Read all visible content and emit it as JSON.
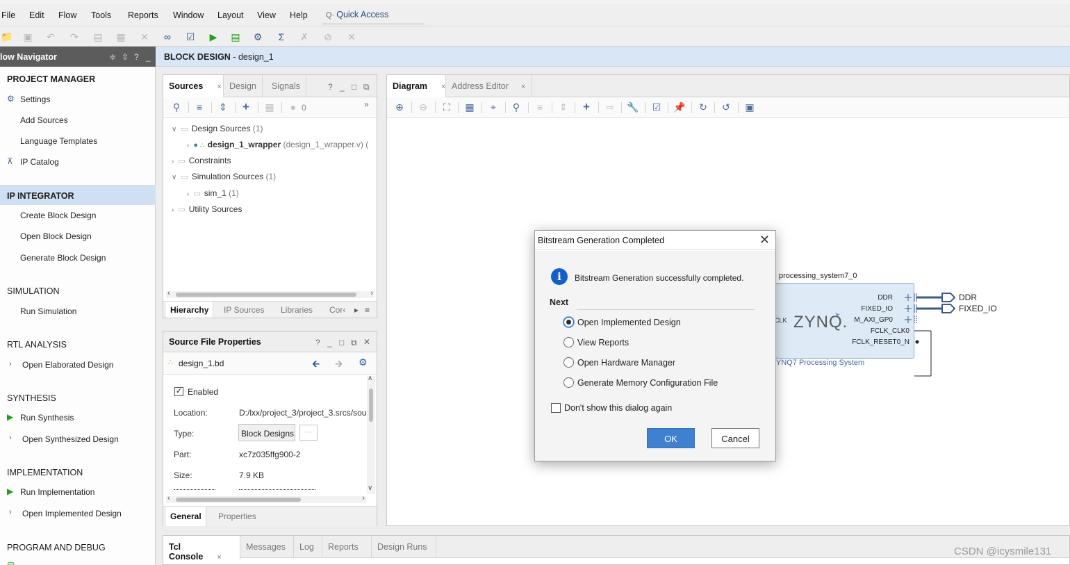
{
  "menubar": {
    "items": [
      "File",
      "Edit",
      "Flow",
      "Tools",
      "Reports",
      "Window",
      "Layout",
      "View",
      "Help"
    ],
    "quick_access": "Quick Access"
  },
  "flow_navigator": {
    "title": "low Navigator",
    "controls": [
      "≑",
      "⇳",
      "?",
      "_"
    ],
    "sections": {
      "project_manager": {
        "label": "PROJECT MANAGER",
        "items": [
          "Settings",
          "Add Sources",
          "Language Templates",
          "IP Catalog"
        ]
      },
      "ip_integrator": {
        "label": "IP INTEGRATOR",
        "items": [
          "Create Block Design",
          "Open Block Design",
          "Generate Block Design"
        ]
      },
      "simulation": {
        "label": "SIMULATION",
        "items": [
          "Run Simulation"
        ]
      },
      "rtl_analysis": {
        "label": "RTL ANALYSIS",
        "items": [
          "Open Elaborated Design"
        ]
      },
      "synthesis": {
        "label": "SYNTHESIS",
        "items": [
          "Run Synthesis",
          "Open Synthesized Design"
        ]
      },
      "implementation": {
        "label": "IMPLEMENTATION",
        "items": [
          "Run Implementation",
          "Open Implemented Design"
        ]
      },
      "program_debug": {
        "label": "PROGRAM AND DEBUG"
      }
    }
  },
  "block_design": {
    "title": "BLOCK DESIGN",
    "name": " - design_1"
  },
  "sources_panel": {
    "tabs": [
      "Sources",
      "Design",
      "Signals"
    ],
    "controls": [
      "?",
      "_",
      "□",
      "⧉"
    ],
    "count": "0",
    "tree": {
      "design_sources": "Design Sources",
      "design_sources_count": "(1)",
      "wrapper": "design_1_wrapper",
      "wrapper_file": "(design_1_wrapper.v) (",
      "constraints": "Constraints",
      "simulation_sources": "Simulation Sources",
      "simulation_sources_count": "(1)",
      "sim": "sim_1",
      "sim_count": "(1)",
      "utility_sources": "Utility Sources"
    },
    "bottom_tabs": [
      "Hierarchy",
      "IP Sources",
      "Libraries",
      "Cor‹"
    ]
  },
  "properties_panel": {
    "title": "Source File Properties",
    "file": "design_1.bd",
    "enabled_label": "Enabled",
    "enabled": true,
    "rows": [
      {
        "label": "Location:",
        "value": "D:/lxx/project_3/project_3.srcs/sou"
      },
      {
        "label": "Type:",
        "value": "Block Designs"
      },
      {
        "label": "Part:",
        "value": "xc7z035ffg900-2"
      },
      {
        "label": "Size:",
        "value": "7.9 KB"
      }
    ],
    "type_more": "···",
    "bottom_tabs": [
      "General",
      "Properties"
    ]
  },
  "diagram_panel": {
    "tabs": [
      "Diagram",
      "Address Editor"
    ]
  },
  "zynq": {
    "instance": "processing_system7_0",
    "logo": "ZYNQ.",
    "clk_label": "CLK",
    "subtitle": "YNQ7 Processing System",
    "ports": [
      "DDR",
      "FIXED_IO",
      "M_AXI_GP0",
      "FCLK_CLK0",
      "FCLK_RESET0_N"
    ],
    "ext_ports": [
      "DDR",
      "FIXED_IO"
    ]
  },
  "dialog": {
    "title": "Bitstream Generation Completed",
    "message": "Bitstream Generation successfully completed.",
    "next_label": "Next",
    "options": [
      {
        "label": "Open Implemented Design",
        "selected": true
      },
      {
        "label": "View Reports",
        "selected": false
      },
      {
        "label": "Open Hardware Manager",
        "selected": false
      },
      {
        "label": "Generate Memory Configuration File",
        "selected": false
      }
    ],
    "dont_show": "Don't show this dialog again",
    "ok": "OK",
    "cancel": "Cancel"
  },
  "tcl_panel": {
    "tabs": [
      "Tcl Console",
      "Messages",
      "Log",
      "Reports",
      "Design Runs"
    ]
  },
  "watermark": "CSDN @icysmile131",
  "colors": {
    "accent": "#4080d0",
    "nav_selected": "#cfe0f3",
    "header_blue": "#d8e6f5",
    "zynq_fill": "#deebf7",
    "run_green": "#1ea01e"
  }
}
